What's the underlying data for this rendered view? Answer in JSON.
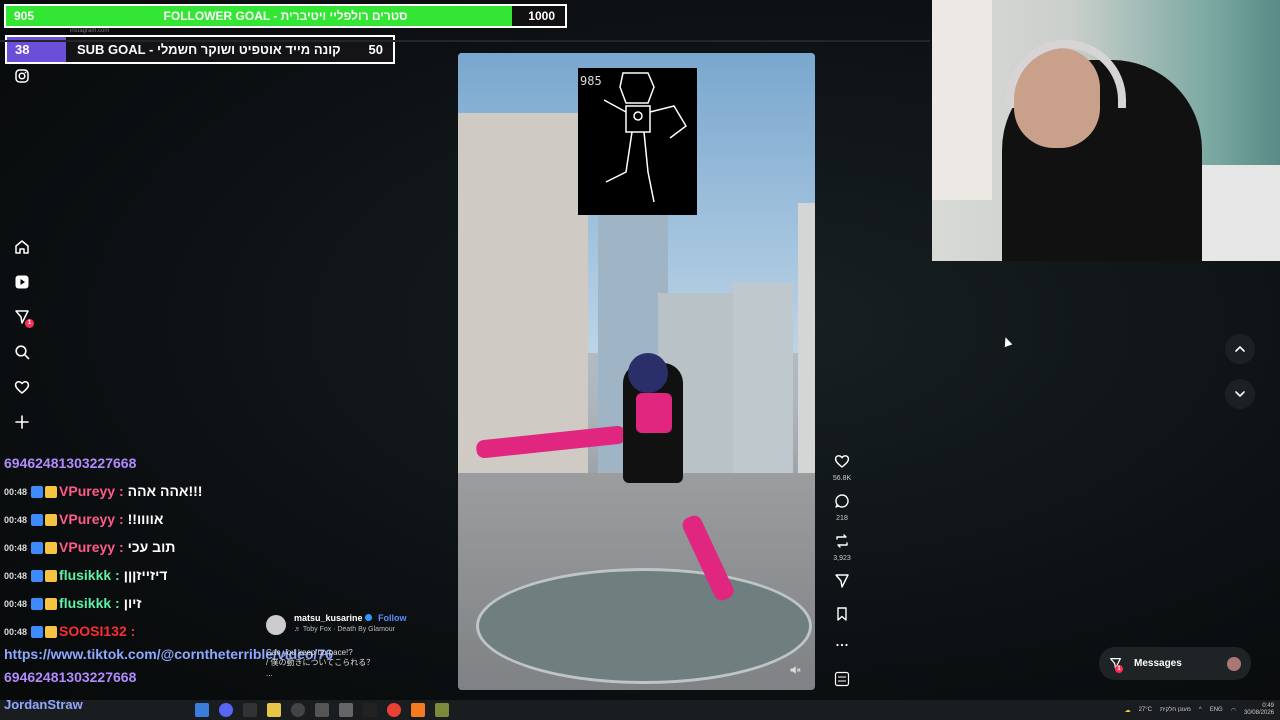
{
  "overlays": {
    "follower_goal": {
      "current": "905",
      "title": "FOLLOWER GOAL - סטרים רולפליי ויטיברית",
      "max": "1000",
      "color": "#34e634",
      "progress": 0.905
    },
    "sub_goal": {
      "current": "38",
      "title": "SUB GOAL - קונה מייד אוטפיט ושוקר חשמלי",
      "max": "50",
      "color": "#6b4fd8",
      "progress": 0.76
    }
  },
  "browser": {
    "url": "instagram.com"
  },
  "sidebar": {
    "items": [
      {
        "icon": "instagram-icon"
      },
      {
        "icon": "home-icon"
      },
      {
        "icon": "reels-icon"
      },
      {
        "icon": "direct-icon",
        "badge": "1"
      },
      {
        "icon": "search-icon"
      },
      {
        "icon": "heart-icon"
      },
      {
        "icon": "plus-icon"
      }
    ]
  },
  "chat": [
    {
      "time": "",
      "user": "",
      "user_color": "#b28bff",
      "msg": "69462481303227668"
    },
    {
      "time": "00:48",
      "user": "VPureyy :",
      "user_color": "#ff5b8a",
      "msg": "אהה אהה!!!"
    },
    {
      "time": "00:48",
      "user": "VPureyy :",
      "user_color": "#ff5b8a",
      "msg": "!!אוווו"
    },
    {
      "time": "00:48",
      "user": "VPureyy :",
      "user_color": "#ff5b8a",
      "msg": "תוב עכי"
    },
    {
      "time": "00:48",
      "user": "flusikkk :",
      "user_color": "#5ff0a8",
      "msg": "דיזייזןןן"
    },
    {
      "time": "00:48",
      "user": "flusikkk :",
      "user_color": "#5ff0a8",
      "msg": "זיון"
    },
    {
      "time": "00:48",
      "user": "SOOSI132 :",
      "user_color": "#ff2d2d",
      "msg": ""
    },
    {
      "time": "",
      "user": "",
      "user_color": "#8fa8ff",
      "msg": "https://www.tiktok.com/@corntheterrible/video/76"
    },
    {
      "time": "",
      "user": "",
      "user_color": "#b28bff",
      "msg": "69462481303227668"
    }
  ],
  "chat_bottom": "JordanStraw",
  "video": {
    "sprite_number": "985",
    "actions": {
      "likes": "56.8K",
      "comments": "218",
      "reposts": "3,923"
    }
  },
  "post": {
    "username": "matsu_kusarine",
    "follow_label": "Follow",
    "song": "♬ Toby Fox · Death By Glamour",
    "caption_line1": "Can you keep up pace!?",
    "caption_line2": "/ 僕の動きについてこられる？",
    "more": "..."
  },
  "messages": {
    "label": "Messages",
    "badge": "1"
  },
  "taskbar": {
    "weather": "27°C",
    "weather_text": "מעונן חלקית",
    "lang": "ENG",
    "time": "0:49",
    "date": "30/08/2026"
  }
}
